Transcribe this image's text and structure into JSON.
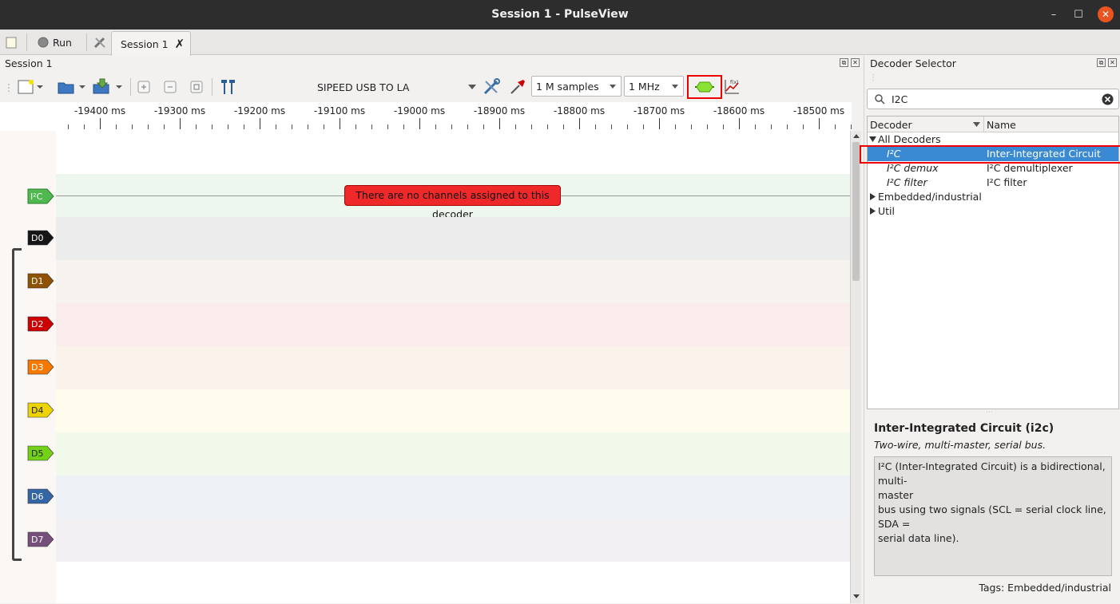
{
  "window": {
    "title": "Session 1 - PulseView",
    "min": "–",
    "max": "☐",
    "close": "✕"
  },
  "tabbar": {
    "run_label": "Run",
    "tab_label": "Session 1",
    "tab_close": "✗"
  },
  "session": {
    "title": "Session 1"
  },
  "toolbar": {
    "device": "SIPEED USB TO LA",
    "samples": "1 M samples",
    "rate": "1 MHz"
  },
  "ruler": {
    "ticks": [
      "-19400 ms",
      "-19300 ms",
      "-19200 ms",
      "-19100 ms",
      "-19000 ms",
      "-18900 ms",
      "-18800 ms",
      "-18700 ms",
      "-18600 ms",
      "-18500 ms"
    ]
  },
  "decoder_trace": {
    "label": "I²C",
    "message": "There are no channels assigned to this decoder",
    "color": "#4fb84f"
  },
  "channels": [
    {
      "label": "D0",
      "color": "#161616",
      "band": "#ececec"
    },
    {
      "label": "D1",
      "color": "#8f5202",
      "band": "#f6f3ef"
    },
    {
      "label": "D2",
      "color": "#cc0000",
      "band": "#fbecec"
    },
    {
      "label": "D3",
      "color": "#f57900",
      "band": "#fcf2ec"
    },
    {
      "label": "D4",
      "color": "#edd400",
      "band": "#fdfced"
    },
    {
      "label": "D5",
      "color": "#73d216",
      "band": "#f1f9ea"
    },
    {
      "label": "D6",
      "color": "#3465a4",
      "band": "#eef1f6"
    },
    {
      "label": "D7",
      "color": "#75507b",
      "band": "#f2eff3"
    }
  ],
  "decoder_selector": {
    "title": "Decoder Selector",
    "search_value": "I2C",
    "col_decoder": "Decoder",
    "col_name": "Name",
    "groups": [
      {
        "label": "All Decoders",
        "expanded": true
      },
      {
        "label": "Embedded/industrial",
        "expanded": false
      },
      {
        "label": "Util",
        "expanded": false
      }
    ],
    "items": [
      {
        "decoder": "I²C",
        "name": "Inter-Integrated Circuit"
      },
      {
        "decoder": "I²C demux",
        "name": "I²C demultiplexer"
      },
      {
        "decoder": "I²C filter",
        "name": "I²C filter"
      }
    ],
    "desc_title": "Inter-Integrated Circuit (i2c)",
    "desc_sub": "Two-wire, multi-master, serial bus.",
    "desc_line1": "I²C (Inter-Integrated Circuit) is a bidirectional, multi-",
    "desc_line2": "master",
    "desc_line3": "bus using two signals (SCL = serial clock line, SDA =",
    "desc_line4": "serial data line).",
    "tags": "Tags: Embedded/industrial"
  }
}
